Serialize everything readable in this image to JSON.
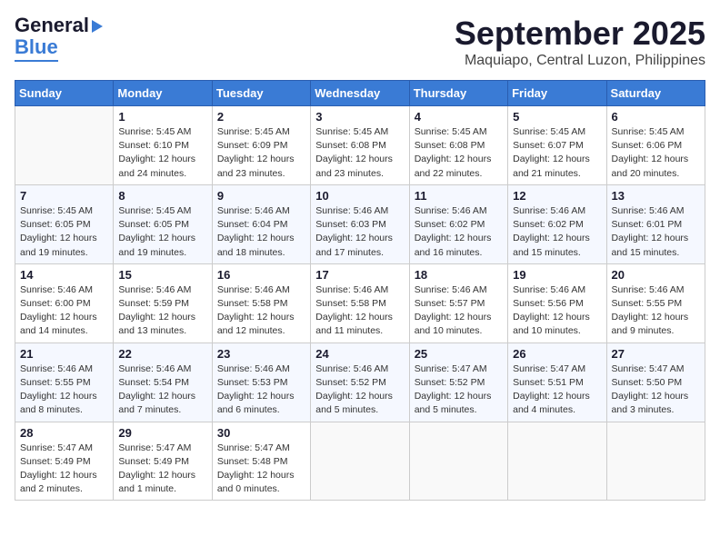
{
  "header": {
    "logo_line1": "General",
    "logo_line2": "Blue",
    "month": "September 2025",
    "location": "Maquiapo, Central Luzon, Philippines"
  },
  "days_of_week": [
    "Sunday",
    "Monday",
    "Tuesday",
    "Wednesday",
    "Thursday",
    "Friday",
    "Saturday"
  ],
  "weeks": [
    [
      {
        "day": "",
        "info": ""
      },
      {
        "day": "1",
        "info": "Sunrise: 5:45 AM\nSunset: 6:10 PM\nDaylight: 12 hours\nand 24 minutes."
      },
      {
        "day": "2",
        "info": "Sunrise: 5:45 AM\nSunset: 6:09 PM\nDaylight: 12 hours\nand 23 minutes."
      },
      {
        "day": "3",
        "info": "Sunrise: 5:45 AM\nSunset: 6:08 PM\nDaylight: 12 hours\nand 23 minutes."
      },
      {
        "day": "4",
        "info": "Sunrise: 5:45 AM\nSunset: 6:08 PM\nDaylight: 12 hours\nand 22 minutes."
      },
      {
        "day": "5",
        "info": "Sunrise: 5:45 AM\nSunset: 6:07 PM\nDaylight: 12 hours\nand 21 minutes."
      },
      {
        "day": "6",
        "info": "Sunrise: 5:45 AM\nSunset: 6:06 PM\nDaylight: 12 hours\nand 20 minutes."
      }
    ],
    [
      {
        "day": "7",
        "info": "Sunrise: 5:45 AM\nSunset: 6:05 PM\nDaylight: 12 hours\nand 19 minutes."
      },
      {
        "day": "8",
        "info": "Sunrise: 5:45 AM\nSunset: 6:05 PM\nDaylight: 12 hours\nand 19 minutes."
      },
      {
        "day": "9",
        "info": "Sunrise: 5:46 AM\nSunset: 6:04 PM\nDaylight: 12 hours\nand 18 minutes."
      },
      {
        "day": "10",
        "info": "Sunrise: 5:46 AM\nSunset: 6:03 PM\nDaylight: 12 hours\nand 17 minutes."
      },
      {
        "day": "11",
        "info": "Sunrise: 5:46 AM\nSunset: 6:02 PM\nDaylight: 12 hours\nand 16 minutes."
      },
      {
        "day": "12",
        "info": "Sunrise: 5:46 AM\nSunset: 6:02 PM\nDaylight: 12 hours\nand 15 minutes."
      },
      {
        "day": "13",
        "info": "Sunrise: 5:46 AM\nSunset: 6:01 PM\nDaylight: 12 hours\nand 15 minutes."
      }
    ],
    [
      {
        "day": "14",
        "info": "Sunrise: 5:46 AM\nSunset: 6:00 PM\nDaylight: 12 hours\nand 14 minutes."
      },
      {
        "day": "15",
        "info": "Sunrise: 5:46 AM\nSunset: 5:59 PM\nDaylight: 12 hours\nand 13 minutes."
      },
      {
        "day": "16",
        "info": "Sunrise: 5:46 AM\nSunset: 5:58 PM\nDaylight: 12 hours\nand 12 minutes."
      },
      {
        "day": "17",
        "info": "Sunrise: 5:46 AM\nSunset: 5:58 PM\nDaylight: 12 hours\nand 11 minutes."
      },
      {
        "day": "18",
        "info": "Sunrise: 5:46 AM\nSunset: 5:57 PM\nDaylight: 12 hours\nand 10 minutes."
      },
      {
        "day": "19",
        "info": "Sunrise: 5:46 AM\nSunset: 5:56 PM\nDaylight: 12 hours\nand 10 minutes."
      },
      {
        "day": "20",
        "info": "Sunrise: 5:46 AM\nSunset: 5:55 PM\nDaylight: 12 hours\nand 9 minutes."
      }
    ],
    [
      {
        "day": "21",
        "info": "Sunrise: 5:46 AM\nSunset: 5:55 PM\nDaylight: 12 hours\nand 8 minutes."
      },
      {
        "day": "22",
        "info": "Sunrise: 5:46 AM\nSunset: 5:54 PM\nDaylight: 12 hours\nand 7 minutes."
      },
      {
        "day": "23",
        "info": "Sunrise: 5:46 AM\nSunset: 5:53 PM\nDaylight: 12 hours\nand 6 minutes."
      },
      {
        "day": "24",
        "info": "Sunrise: 5:46 AM\nSunset: 5:52 PM\nDaylight: 12 hours\nand 5 minutes."
      },
      {
        "day": "25",
        "info": "Sunrise: 5:47 AM\nSunset: 5:52 PM\nDaylight: 12 hours\nand 5 minutes."
      },
      {
        "day": "26",
        "info": "Sunrise: 5:47 AM\nSunset: 5:51 PM\nDaylight: 12 hours\nand 4 minutes."
      },
      {
        "day": "27",
        "info": "Sunrise: 5:47 AM\nSunset: 5:50 PM\nDaylight: 12 hours\nand 3 minutes."
      }
    ],
    [
      {
        "day": "28",
        "info": "Sunrise: 5:47 AM\nSunset: 5:49 PM\nDaylight: 12 hours\nand 2 minutes."
      },
      {
        "day": "29",
        "info": "Sunrise: 5:47 AM\nSunset: 5:49 PM\nDaylight: 12 hours\nand 1 minute."
      },
      {
        "day": "30",
        "info": "Sunrise: 5:47 AM\nSunset: 5:48 PM\nDaylight: 12 hours\nand 0 minutes."
      },
      {
        "day": "",
        "info": ""
      },
      {
        "day": "",
        "info": ""
      },
      {
        "day": "",
        "info": ""
      },
      {
        "day": "",
        "info": ""
      }
    ]
  ]
}
